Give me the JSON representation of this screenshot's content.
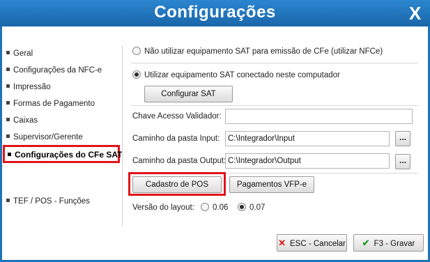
{
  "window": {
    "title": "Configurações",
    "close_label": "X"
  },
  "sidebar": {
    "items": [
      {
        "label": "Geral"
      },
      {
        "label": "Configurações da NFC-e"
      },
      {
        "label": "Impressão"
      },
      {
        "label": "Formas de Pagamento"
      },
      {
        "label": "Caixas"
      },
      {
        "label": "Supervisor/Gerente"
      },
      {
        "label": "Configurações do CFe SAT",
        "active": true
      },
      {
        "label": "TEF / POS - Funções"
      }
    ]
  },
  "main": {
    "radio_no_sat": {
      "label": "Não utilizar equipamento SAT para emissão de CFe (utilizar NFCe)",
      "checked": false
    },
    "radio_use_sat": {
      "label": "Utilizar equipamento SAT conectado neste computador",
      "checked": true
    },
    "configure_sat_label": "Configurar SAT",
    "chave_acesso": {
      "label": "Chave Acesso Validador:",
      "value": ""
    },
    "input_path": {
      "label": "Caminho da pasta Input:",
      "value": "C:\\Integrador\\Input",
      "browse_label": "..."
    },
    "output_path": {
      "label": "Caminho da pasta Output:",
      "value": "C:\\Integrador\\Output",
      "browse_label": "..."
    },
    "cadastro_pos_label": "Cadastro de POS",
    "pagamentos_vfp_label": "Pagamentos VFP-e",
    "layout_version": {
      "label": "Versão do layout:",
      "options": [
        {
          "label": "0.06",
          "checked": false
        },
        {
          "label": "0.07",
          "checked": true
        }
      ]
    }
  },
  "footer": {
    "cancel_label": "ESC - Cancelar",
    "save_label": "F3 - Gravar"
  },
  "colors": {
    "titlebar": "#1f73b7",
    "highlight": "#e0141b"
  }
}
